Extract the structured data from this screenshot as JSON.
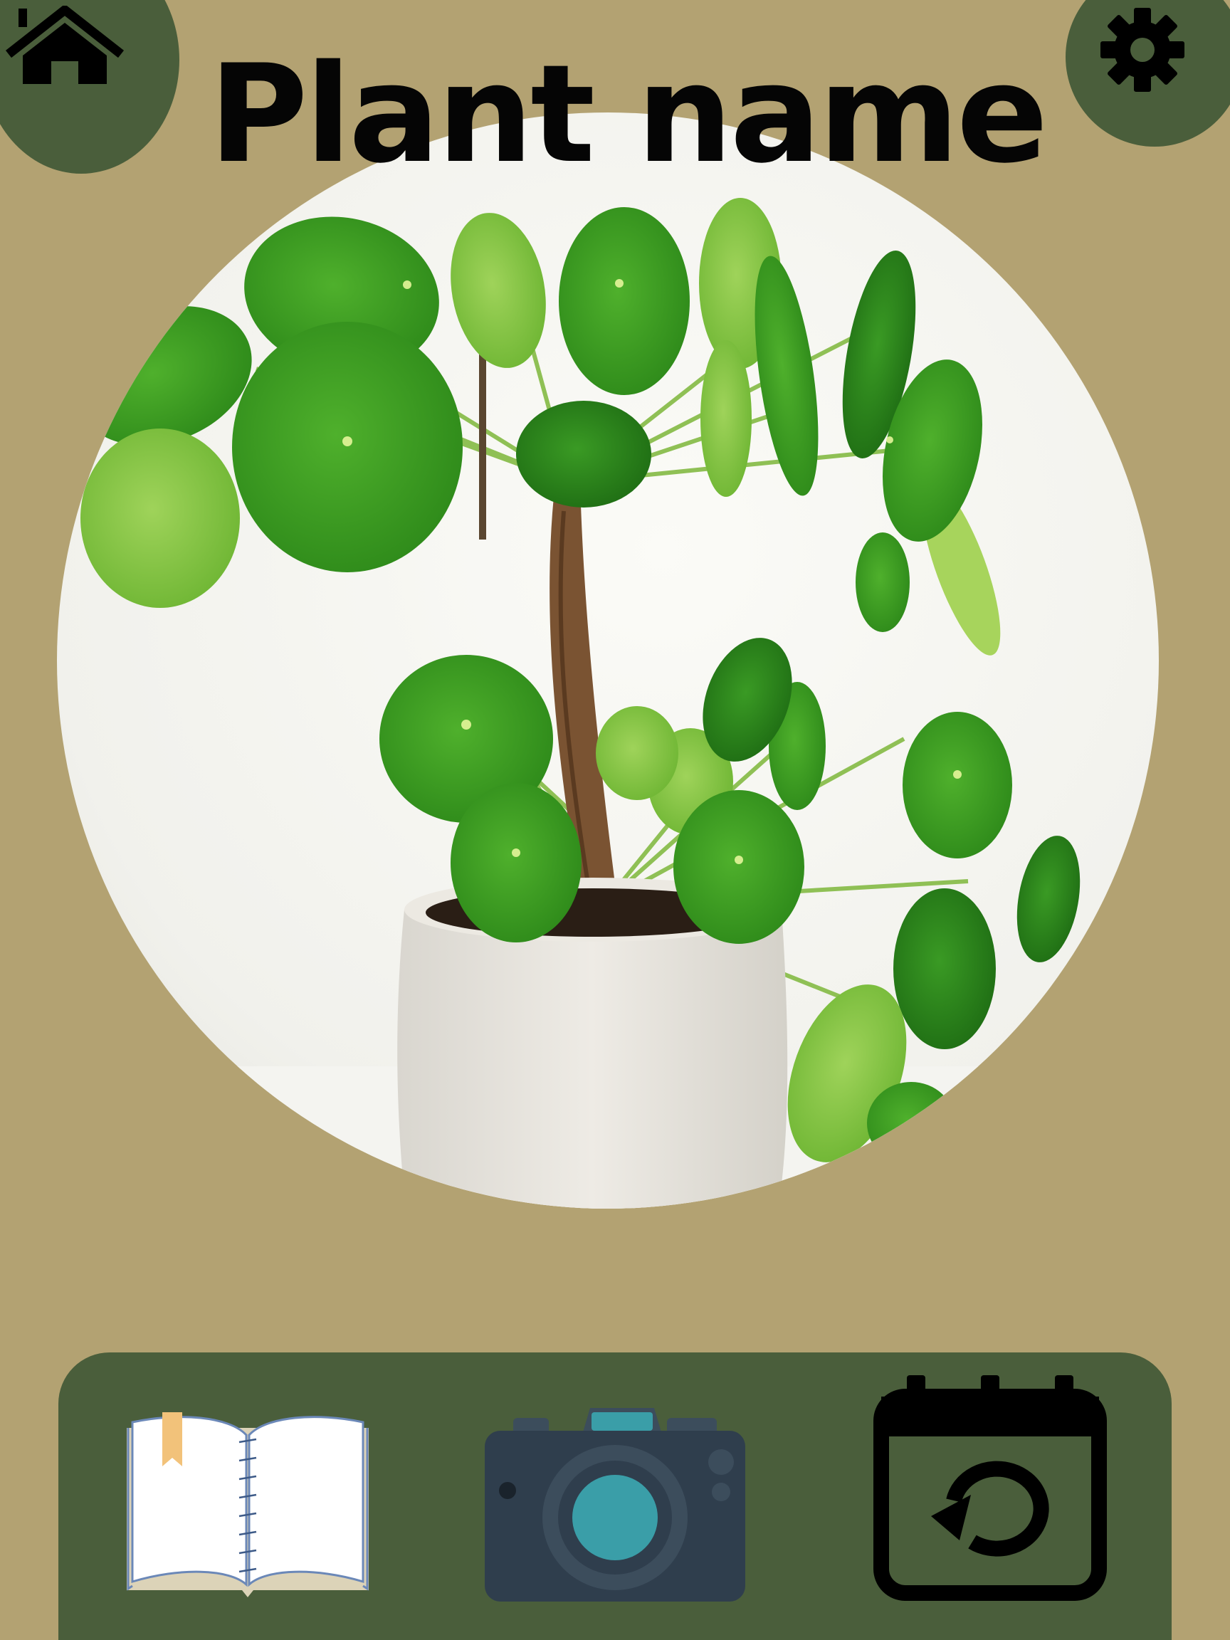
{
  "app": {
    "title": "Plant name"
  },
  "photo": {
    "subject": "plant-photo"
  },
  "header": {
    "home_icon": "home-icon",
    "settings_icon": "gear-icon"
  },
  "toolbar": {
    "items": [
      {
        "icon": "open-book-icon"
      },
      {
        "icon": "camera-icon"
      },
      {
        "icon": "calendar-refresh-icon"
      }
    ]
  },
  "colors": {
    "background": "#b3a272",
    "accent_green": "#4a5e3b",
    "title_text": "#050505"
  }
}
